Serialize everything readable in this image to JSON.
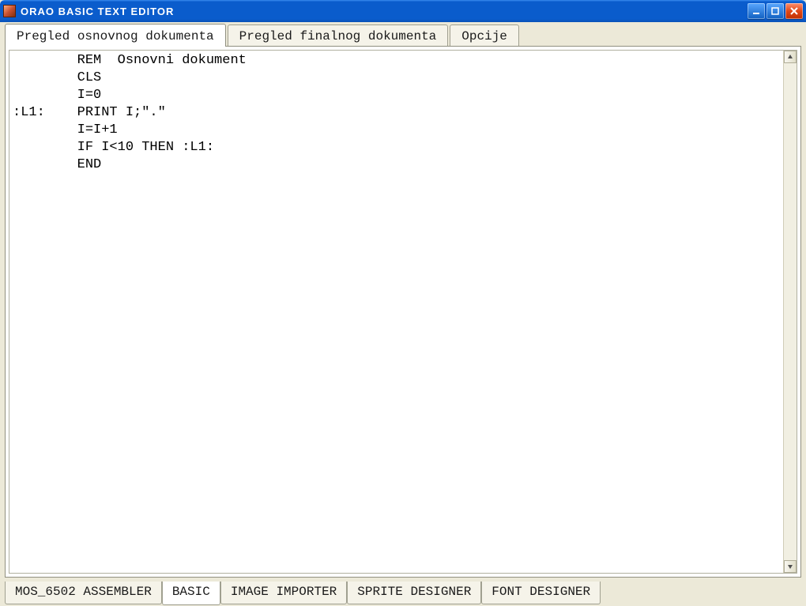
{
  "window": {
    "title": "ORAO  BASIC  TEXT  EDITOR"
  },
  "top_tabs": {
    "items": [
      {
        "label": "Pregled osnovnog dokumenta",
        "active": true
      },
      {
        "label": "Pregled finalnog dokumenta",
        "active": false
      },
      {
        "label": "Opcije",
        "active": false
      }
    ]
  },
  "editor": {
    "code": "        REM  Osnovni dokument\n        CLS\n        I=0\n:L1:    PRINT I;\".\"\n        I=I+1\n        IF I<10 THEN :L1:\n        END"
  },
  "bottom_tabs": {
    "items": [
      {
        "label": "MOS_6502 ASSEMBLER",
        "active": false
      },
      {
        "label": "BASIC",
        "active": true
      },
      {
        "label": "IMAGE IMPORTER",
        "active": false
      },
      {
        "label": "SPRITE DESIGNER",
        "active": false
      },
      {
        "label": "FONT DESIGNER",
        "active": false
      }
    ]
  }
}
